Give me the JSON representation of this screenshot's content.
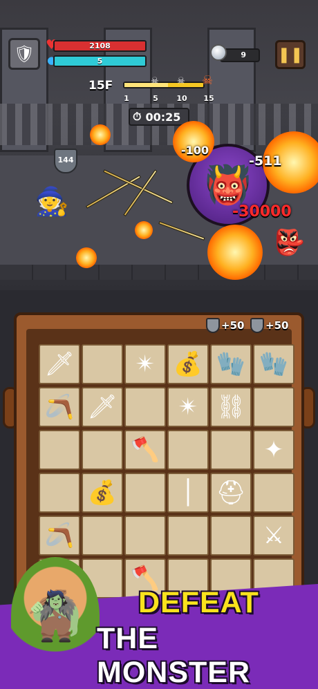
{
  "hud": {
    "avatar_icon": "knight-helmet-icon",
    "hp_value": "2108",
    "mp_value": "5",
    "gems": "9",
    "pause_label": "❚❚"
  },
  "stage": {
    "floor_label": "15F",
    "progress_fraction": 0.55,
    "progress_ticks": [
      "1",
      "5",
      "10",
      "15"
    ],
    "timer": "00:25",
    "shield_value": "144",
    "damage_numbers": [
      "-100",
      "-511",
      "-30000"
    ]
  },
  "inventory": {
    "bonuses": [
      "+50",
      "+50"
    ],
    "items": [
      {
        "icon": "dagger-icon",
        "glyph": "🗡"
      },
      {
        "icon": "shuriken-icon",
        "glyph": "✴"
      },
      {
        "icon": "money-bag-icon",
        "glyph": "💰"
      },
      {
        "icon": "gauntlet-icon",
        "glyph": "🧤"
      },
      {
        "icon": "gauntlet-icon",
        "glyph": "🧤"
      },
      {
        "icon": "boomerang-icon",
        "glyph": "🪃"
      },
      {
        "icon": "golden-dagger-icon",
        "glyph": "🗡"
      },
      {
        "icon": "shuriken-icon",
        "glyph": "✴"
      },
      {
        "icon": "chain-flail-icon",
        "glyph": "⛓"
      },
      {
        "icon": "throwing-star-icon",
        "glyph": "✦"
      },
      {
        "icon": "ice-axe-icon",
        "glyph": "🪓"
      },
      {
        "icon": "money-bag-icon",
        "glyph": "💰"
      },
      {
        "icon": "staff-icon",
        "glyph": "│"
      },
      {
        "icon": "helmet-icon",
        "glyph": "⛑"
      },
      {
        "icon": "sword-icon",
        "glyph": "⚔"
      },
      {
        "icon": "boomerang-icon",
        "glyph": "🪃"
      },
      {
        "icon": "battle-axe-icon",
        "glyph": "🪓"
      }
    ]
  },
  "banner": {
    "line1": "DEFEAT",
    "line2": "THE MONSTER"
  },
  "colors": {
    "hp": "#d93031",
    "mp": "#2fcad6",
    "banner": "#7b2bb8",
    "title_yellow": "#f9e21d"
  }
}
